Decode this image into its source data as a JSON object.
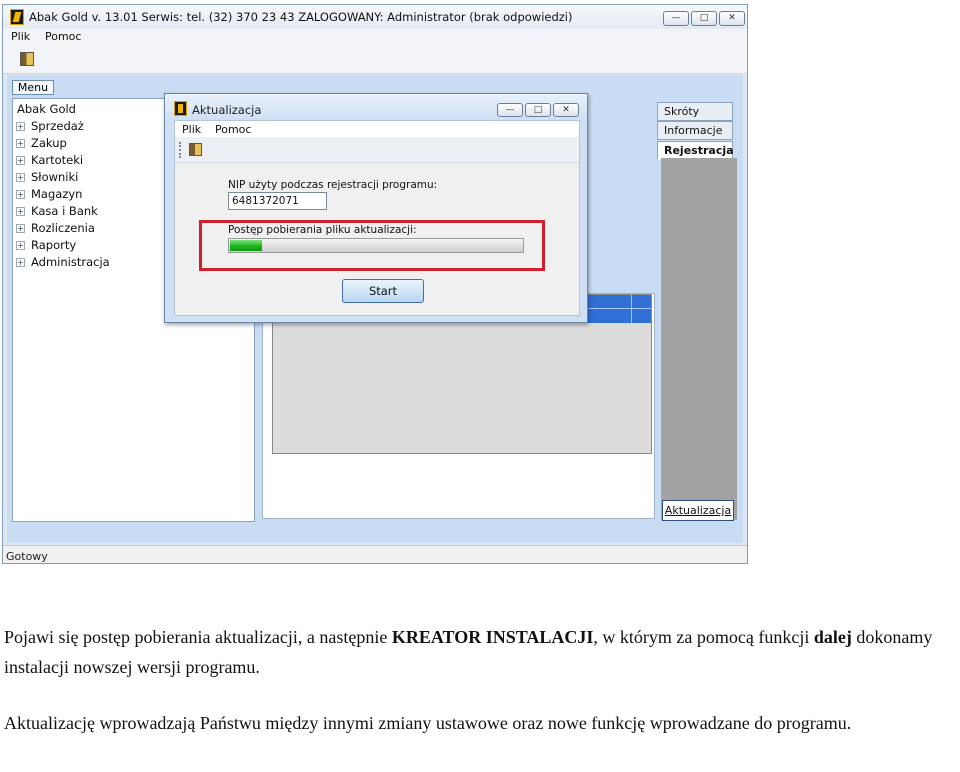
{
  "window": {
    "title": "Abak Gold v. 13.01 Serwis: tel. (32) 370 23 43 ZALOGOWANY: Administrator (brak odpowiedzi)",
    "menu": [
      "Plik",
      "Pomoc"
    ],
    "status": "Gotowy"
  },
  "sidebar": {
    "menu_tab": "Menu",
    "root": "Abak Gold",
    "items": [
      "Sprzedaż",
      "Zakup",
      "Kartoteki",
      "Słowniki",
      "Magazyn",
      "Kasa i Bank",
      "Rozliczenia",
      "Raporty",
      "Administracja"
    ]
  },
  "right_tabs": [
    "Skróty",
    "Informacje",
    "Rejestracja"
  ],
  "right_button": "Aktualizacja",
  "dialog": {
    "title": "Aktualizacja",
    "menu": [
      "Plik",
      "Pomoc"
    ],
    "nip_label": "NIP użyty podczas rejestracji programu:",
    "nip_value": "6481372071",
    "progress_label": "Postęp pobierania pliku aktualizacji:",
    "progress_fraction": 0.11,
    "start_label": "Start"
  },
  "caption": {
    "p1_a": "Pojawi się postęp pobierania aktualizacji, a następnie ",
    "p1_b": "KREATOR INSTALACJI",
    "p1_c": ", w którym za pomocą funkcji ",
    "p1_d": "dalej",
    "p1_e": " dokonamy instalacji nowszej wersji programu.",
    "p2": "Aktualizację wprowadzają Państwu między innymi zmiany ustawowe oraz nowe funkcję wprowadzane do programu."
  },
  "colors": {
    "highlight": "#d0202e",
    "progress": "#1fb21f",
    "grid_header": "#2f6fd6"
  }
}
